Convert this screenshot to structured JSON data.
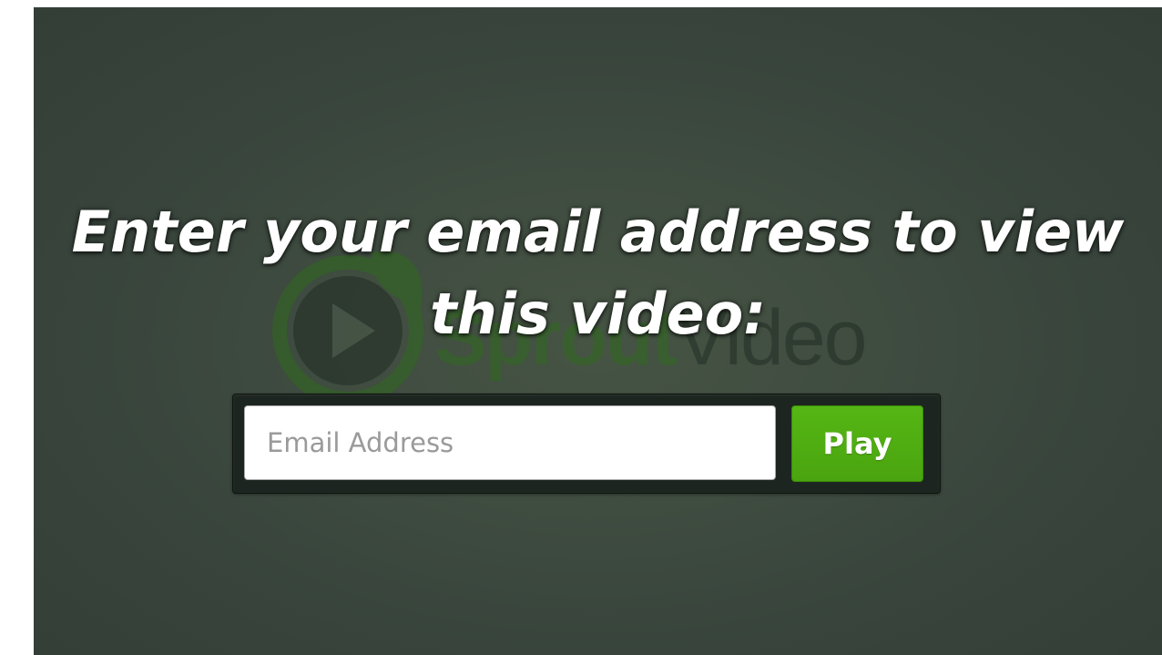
{
  "brand": {
    "logo_word_part1": "Sprout",
    "logo_word_part2": "Video",
    "colors": {
      "background": "#3f4c40",
      "logo_green": "#2f6b1c",
      "button_green": "#4fad12"
    },
    "icons": [
      "play-circle-logo-icon",
      "leaf-icon"
    ]
  },
  "gate": {
    "heading": "Enter your email address to view this video:",
    "email_value": "",
    "email_placeholder": "Email Address",
    "play_label": "Play"
  }
}
